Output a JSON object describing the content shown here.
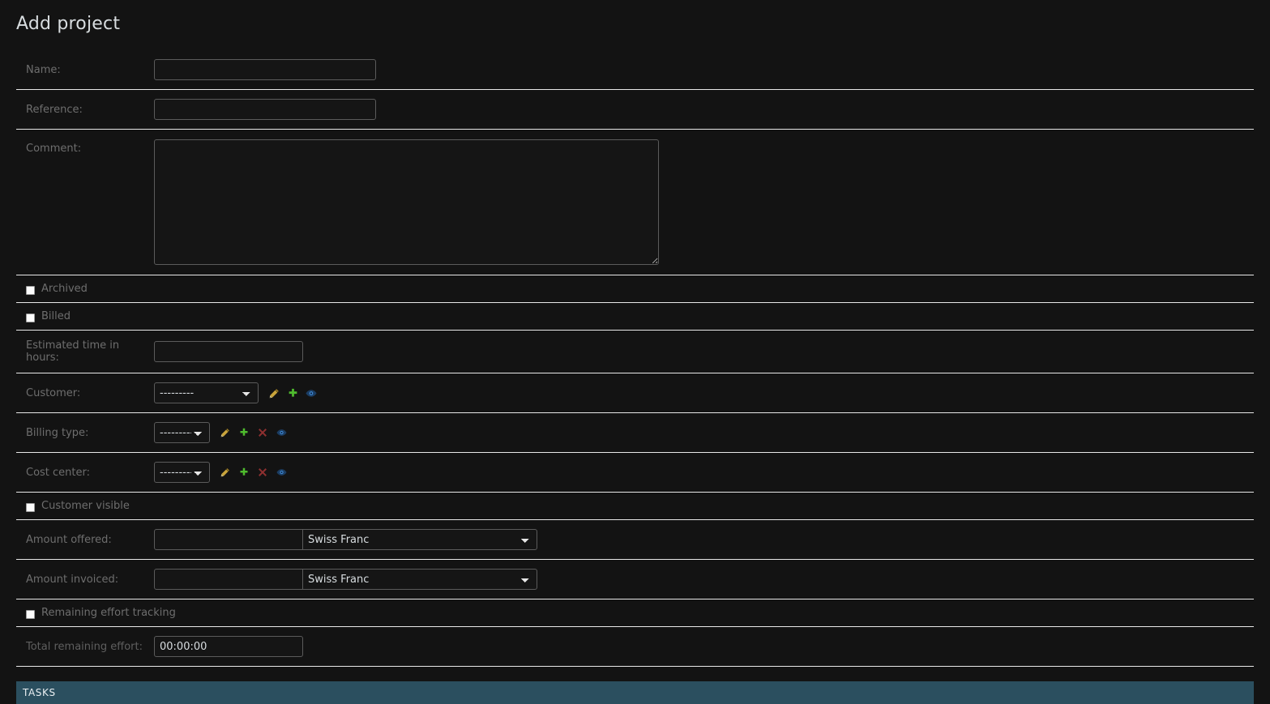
{
  "page": {
    "title": "Add project",
    "accent_teal": "#2b4f5f",
    "background": "#131313",
    "label_color": "#6e6e6e",
    "divider_color": "#e8e8e8"
  },
  "form": {
    "rows": [
      {
        "key": "name",
        "label": "Name:",
        "value": "",
        "placeholder": ""
      },
      {
        "key": "reference",
        "label": "Reference:",
        "value": "",
        "placeholder": ""
      },
      {
        "key": "comment",
        "label": "Comment:",
        "value": "",
        "placeholder": ""
      },
      {
        "key": "archived",
        "label": "Archived",
        "checked": false
      },
      {
        "key": "billed",
        "label": "Billed",
        "checked": false
      },
      {
        "key": "estimated",
        "label": "Estimated time in hours:",
        "value": "",
        "placeholder": ""
      },
      {
        "key": "customer",
        "label": "Customer:",
        "selected": "---------"
      },
      {
        "key": "billing",
        "label": "Billing type:",
        "selected": "---------"
      },
      {
        "key": "cost",
        "label": "Cost center:",
        "selected": "---------"
      },
      {
        "key": "cust_vis",
        "label": "Customer visible",
        "checked": false
      },
      {
        "key": "offered",
        "label": "Amount offered:",
        "value": "",
        "currency": "Swiss Franc"
      },
      {
        "key": "invoiced",
        "label": "Amount invoiced:",
        "value": "",
        "currency": "Swiss Franc"
      },
      {
        "key": "rem_track",
        "label": "Remaining effort tracking",
        "checked": false
      },
      {
        "key": "total_rem",
        "label": "Total remaining effort:",
        "value": "00:00:00"
      }
    ]
  },
  "fields": {
    "name_label": "Name:",
    "reference_label": "Reference:",
    "comment_label": "Comment:",
    "archived_label": "Archived",
    "billed_label": "Billed",
    "estimated_label": "Estimated time in hours:",
    "customer_label": "Customer:",
    "billing_type_label": "Billing type:",
    "cost_center_label": "Cost center:",
    "customer_visible_label": "Customer visible",
    "amount_offered_label": "Amount offered:",
    "amount_invoiced_label": "Amount invoiced:",
    "remaining_effort_tracking_label": "Remaining effort tracking",
    "total_remaining_effort_label": "Total remaining effort:"
  },
  "values": {
    "name": "",
    "reference": "",
    "comment": "",
    "estimated_time": "",
    "customer_select": "---------",
    "billing_type_select": "---------",
    "cost_center_select": "---------",
    "amount_offered": "",
    "amount_offered_currency": "Swiss Franc",
    "amount_invoiced": "",
    "amount_invoiced_currency": "Swiss Franc",
    "total_remaining_effort": "00:00:00",
    "empty_option": "---------"
  },
  "icons": {
    "edit": "pencil-icon",
    "add": "plus-icon",
    "delete": "cross-icon",
    "view": "eye-icon",
    "edit_color": "#b8912f",
    "add_color": "#4fbb2e",
    "delete_color": "#8f3030",
    "view_color": "#2f6fb8"
  },
  "tasks": {
    "title": "TASKS"
  }
}
